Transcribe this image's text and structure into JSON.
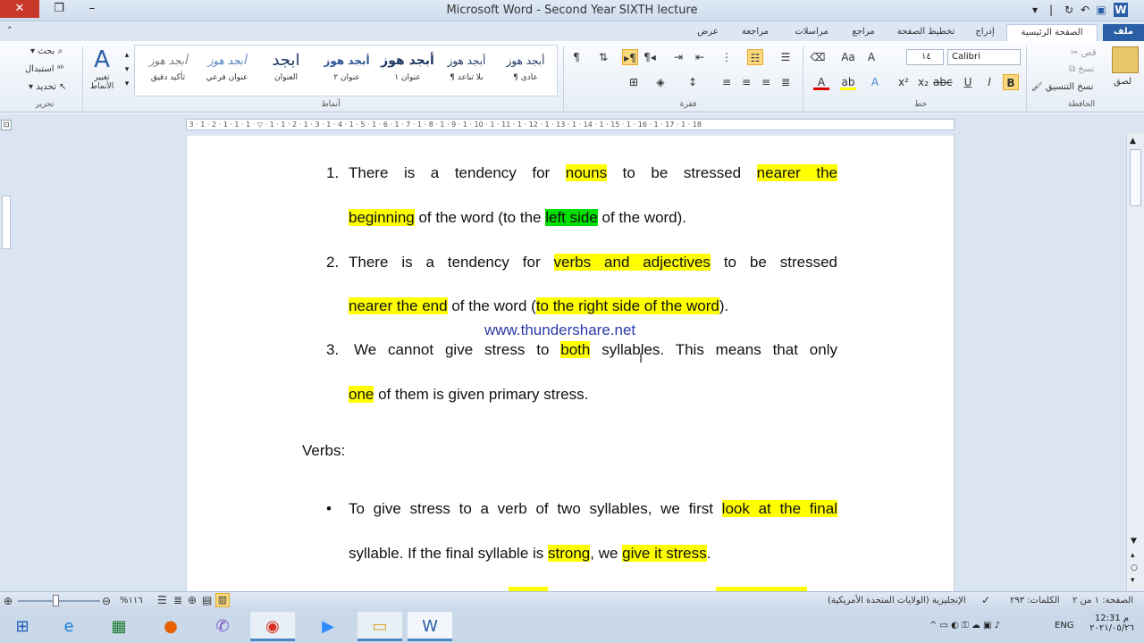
{
  "window": {
    "title_app": "Microsoft Word",
    "title_sep": "-",
    "title_doc": "Second Year SIXTH lecture"
  },
  "tabs": [
    {
      "label": "ملف"
    },
    {
      "label": "الصفحة الرئيسية"
    },
    {
      "label": "إدراج"
    },
    {
      "label": "تخطيط الصفحة"
    },
    {
      "label": "مراجع"
    },
    {
      "label": "مراسلات"
    },
    {
      "label": "مراجعة"
    },
    {
      "label": "عرض"
    }
  ],
  "clipboard": {
    "paste": "لصق",
    "cut": "قص",
    "copy": "نسخ",
    "format_painter": "نسخ التنسيق",
    "group": "الحافظة"
  },
  "font": {
    "name": "Calibri",
    "size": "١٤",
    "group": "خط"
  },
  "paragraph": {
    "group": "فقرة"
  },
  "styles": {
    "group": "أنماط",
    "items": [
      {
        "sample": "أبجد هوز",
        "name": "¶ عادي"
      },
      {
        "sample": "أبجد هوز",
        "name": "¶ بلا تباعد"
      },
      {
        "sample": "أبجد هوز",
        "name": "عنوان ١"
      },
      {
        "sample": "أبجد هوز",
        "name": "عنوان ٢"
      },
      {
        "sample": "ابجد",
        "name": "العنوان"
      },
      {
        "sample": "أبجد هوز",
        "name": "عنوان فرعي"
      },
      {
        "sample": "أبجد هوز",
        "name": "تأكيد دقيق"
      }
    ],
    "change_styles": "تغيير الأنماط"
  },
  "editing": {
    "find": "بحث",
    "replace": "استبدال",
    "select": "تحديد",
    "group": "تحرير"
  },
  "document": {
    "item1": {
      "num": "1.",
      "l1": [
        "There is a tendency for ",
        "nouns",
        " to be stressed ",
        "nearer the"
      ],
      "l2": [
        "beginning",
        " of the word (to the ",
        "left side",
        " of the word)."
      ]
    },
    "item2": {
      "num": "2.",
      "l1": [
        "There is a tendency for ",
        "verbs and adjectives",
        " to be stressed"
      ],
      "l2": [
        "nearer the end",
        " of the word (",
        "to the right side of the word",
        ")."
      ]
    },
    "watermark": "www.thundershare.net",
    "item3": {
      "num": "3.",
      "l1": [
        "We cannot give stress to ",
        "both",
        " syllables. This means that only"
      ],
      "l2": [
        "one",
        " of them is given primary stress."
      ]
    },
    "heading": "Verbs:",
    "bullet1": {
      "l1": [
        "To give stress to a verb of two syllables, we first ",
        "look at the final"
      ],
      "l2": [
        "syllable. If the final syllable is ",
        "strong",
        ", we ",
        "give it stress",
        "."
      ]
    }
  },
  "status": {
    "page": "الصفحة: ١ من ٢",
    "words": "الكلمات: ٢٩٣",
    "language": "الإنجليزية (الولايات المتحدة الأمريكية)",
    "zoom": "%١١٦"
  },
  "taskbar": {
    "lang": "ENG",
    "time": "12:31 م",
    "date": "٢٠٢١/٠٥/٢٦"
  },
  "colors": {
    "highlight_yellow": "#ffff00",
    "highlight_green": "#00e000",
    "file_tab": "#2a5ea7",
    "watermark": "#2a3aa8"
  }
}
